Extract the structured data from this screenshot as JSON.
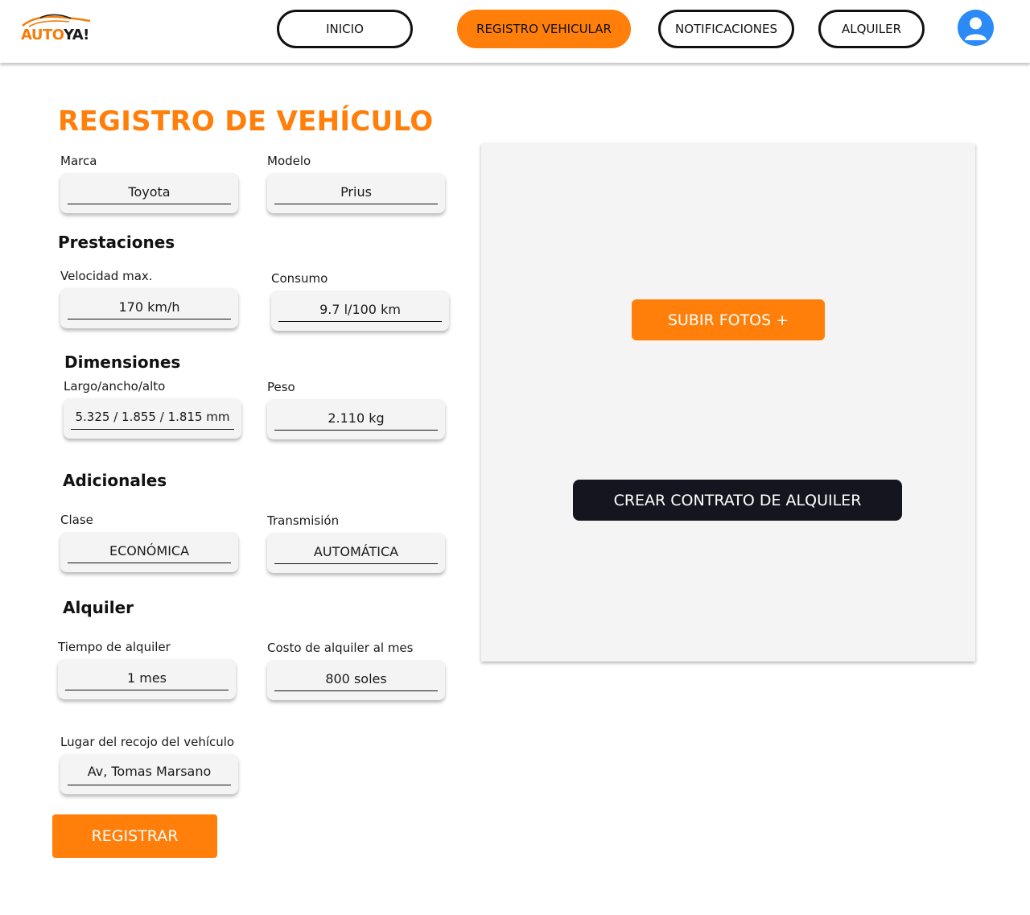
{
  "brand": {
    "logo_part1": "AUTO",
    "logo_part2": "YA!"
  },
  "nav": {
    "inicio": "INICIO",
    "registro": "REGISTRO VEHICULAR",
    "notificaciones": "NOTIFICACIONES",
    "alquiler": "ALQUILER"
  },
  "page_title": "REGISTRO DE VEHÍCULO",
  "form": {
    "marca": {
      "label": "Marca",
      "value": "Toyota"
    },
    "modelo": {
      "label": "Modelo",
      "value": "Prius"
    },
    "prestaciones_title": "Prestaciones",
    "velocidad": {
      "label": "Velocidad max.",
      "value": "170 km/h"
    },
    "consumo": {
      "label": "Consumo",
      "value": "9.7 l/100 km"
    },
    "dimensiones_title": "Dimensiones",
    "dimensiones": {
      "label": "Largo/ancho/alto",
      "value": "5.325 / 1.855 / 1.815 mm"
    },
    "peso": {
      "label": "Peso",
      "value": "2.110 kg"
    },
    "adicionales_title": "Adicionales",
    "clase": {
      "label": "Clase",
      "value": "ECONÓMICA"
    },
    "transmision": {
      "label": "Transmisión",
      "value": "AUTOMÁTICA"
    },
    "alquiler_title": "Alquiler",
    "tiempo": {
      "label": "Tiempo de alquiler",
      "value": "1 mes"
    },
    "costo": {
      "label": "Costo de alquiler al mes",
      "value": "800 soles"
    },
    "lugar": {
      "label": "Lugar del recojo del vehículo",
      "value": "Av, Tomas Marsano"
    },
    "submit_label": "REGISTRAR"
  },
  "panel": {
    "upload_label": "SUBIR FOTOS +",
    "contract_label": "CREAR CONTRATO DE ALQUILER"
  },
  "colors": {
    "accent": "#ff7f0a",
    "dark": "#15151f",
    "panel": "#f4f4f4",
    "avatar": "#2b8af6"
  }
}
